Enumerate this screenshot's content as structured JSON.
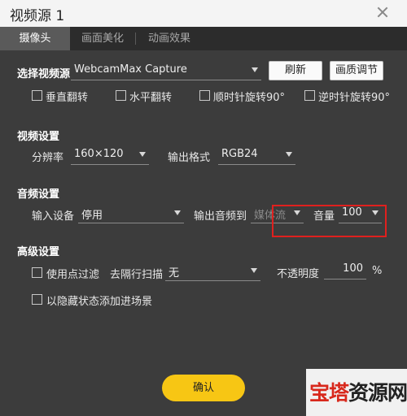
{
  "window": {
    "title": "视频源 1"
  },
  "tabs": [
    {
      "label": "摄像头",
      "active": true
    },
    {
      "label": "画面美化",
      "active": false
    },
    {
      "label": "动画效果",
      "active": false
    }
  ],
  "source": {
    "label": "选择视频源",
    "device": "WebcamMax Capture",
    "refresh_label": "刷新",
    "quality_label": "画质调节"
  },
  "flip": {
    "vertical": {
      "label": "垂直翻转",
      "checked": false
    },
    "horizontal": {
      "label": "水平翻转",
      "checked": false
    },
    "cw90": {
      "label": "顺时针旋转90°",
      "checked": false
    },
    "ccw90": {
      "label": "逆时针旋转90°",
      "checked": false
    }
  },
  "video_settings": {
    "title": "视频设置",
    "resolution_label": "分辨率",
    "resolution": "160×120",
    "format_label": "输出格式",
    "format": "RGB24"
  },
  "audio_settings": {
    "title": "音频设置",
    "input_label": "输入设备",
    "input": "停用",
    "output_label": "输出音频到",
    "output": "媒体流",
    "volume_label": "音量",
    "volume": "100"
  },
  "advanced": {
    "title": "高级设置",
    "point_filter_label": "使用点过滤",
    "point_filter_checked": false,
    "deinterlace_label": "去隔行扫描",
    "deinterlace": "无",
    "opacity_label": "不透明度",
    "opacity": "100",
    "opacity_unit": "%",
    "hidden_add_label": "以隐藏状态添加进场景",
    "hidden_add_checked": false
  },
  "confirm_label": "确认",
  "watermark": {
    "part1": "宝塔",
    "part2": "资源网"
  },
  "colors": {
    "accent": "#f7c614",
    "highlight": "#e0201e",
    "tab_active": "#5a5a5a",
    "background": "#3c3c3c"
  }
}
